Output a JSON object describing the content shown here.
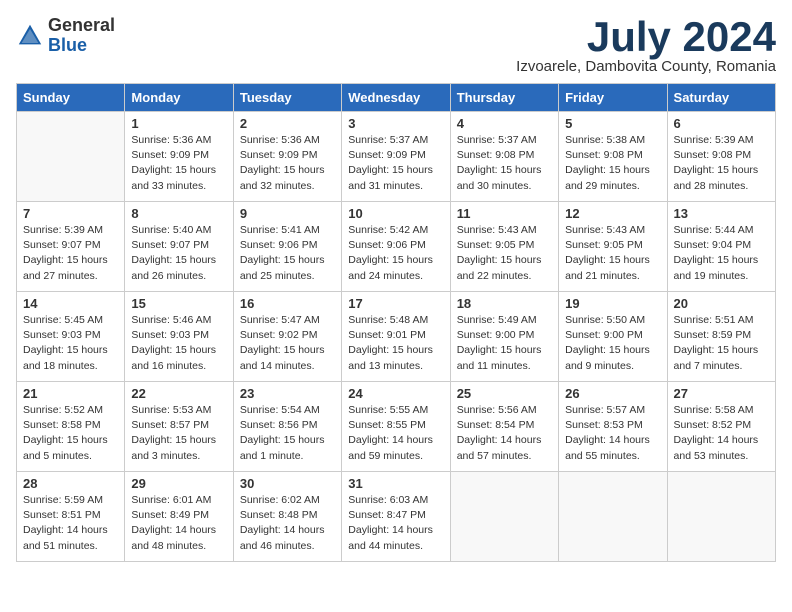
{
  "header": {
    "logo_general": "General",
    "logo_blue": "Blue",
    "title": "July 2024",
    "subtitle": "Izvoarele, Dambovita County, Romania"
  },
  "weekdays": [
    "Sunday",
    "Monday",
    "Tuesday",
    "Wednesday",
    "Thursday",
    "Friday",
    "Saturday"
  ],
  "weeks": [
    [
      {
        "day": "",
        "info": ""
      },
      {
        "day": "1",
        "info": "Sunrise: 5:36 AM\nSunset: 9:09 PM\nDaylight: 15 hours\nand 33 minutes."
      },
      {
        "day": "2",
        "info": "Sunrise: 5:36 AM\nSunset: 9:09 PM\nDaylight: 15 hours\nand 32 minutes."
      },
      {
        "day": "3",
        "info": "Sunrise: 5:37 AM\nSunset: 9:09 PM\nDaylight: 15 hours\nand 31 minutes."
      },
      {
        "day": "4",
        "info": "Sunrise: 5:37 AM\nSunset: 9:08 PM\nDaylight: 15 hours\nand 30 minutes."
      },
      {
        "day": "5",
        "info": "Sunrise: 5:38 AM\nSunset: 9:08 PM\nDaylight: 15 hours\nand 29 minutes."
      },
      {
        "day": "6",
        "info": "Sunrise: 5:39 AM\nSunset: 9:08 PM\nDaylight: 15 hours\nand 28 minutes."
      }
    ],
    [
      {
        "day": "7",
        "info": "Sunrise: 5:39 AM\nSunset: 9:07 PM\nDaylight: 15 hours\nand 27 minutes."
      },
      {
        "day": "8",
        "info": "Sunrise: 5:40 AM\nSunset: 9:07 PM\nDaylight: 15 hours\nand 26 minutes."
      },
      {
        "day": "9",
        "info": "Sunrise: 5:41 AM\nSunset: 9:06 PM\nDaylight: 15 hours\nand 25 minutes."
      },
      {
        "day": "10",
        "info": "Sunrise: 5:42 AM\nSunset: 9:06 PM\nDaylight: 15 hours\nand 24 minutes."
      },
      {
        "day": "11",
        "info": "Sunrise: 5:43 AM\nSunset: 9:05 PM\nDaylight: 15 hours\nand 22 minutes."
      },
      {
        "day": "12",
        "info": "Sunrise: 5:43 AM\nSunset: 9:05 PM\nDaylight: 15 hours\nand 21 minutes."
      },
      {
        "day": "13",
        "info": "Sunrise: 5:44 AM\nSunset: 9:04 PM\nDaylight: 15 hours\nand 19 minutes."
      }
    ],
    [
      {
        "day": "14",
        "info": "Sunrise: 5:45 AM\nSunset: 9:03 PM\nDaylight: 15 hours\nand 18 minutes."
      },
      {
        "day": "15",
        "info": "Sunrise: 5:46 AM\nSunset: 9:03 PM\nDaylight: 15 hours\nand 16 minutes."
      },
      {
        "day": "16",
        "info": "Sunrise: 5:47 AM\nSunset: 9:02 PM\nDaylight: 15 hours\nand 14 minutes."
      },
      {
        "day": "17",
        "info": "Sunrise: 5:48 AM\nSunset: 9:01 PM\nDaylight: 15 hours\nand 13 minutes."
      },
      {
        "day": "18",
        "info": "Sunrise: 5:49 AM\nSunset: 9:00 PM\nDaylight: 15 hours\nand 11 minutes."
      },
      {
        "day": "19",
        "info": "Sunrise: 5:50 AM\nSunset: 9:00 PM\nDaylight: 15 hours\nand 9 minutes."
      },
      {
        "day": "20",
        "info": "Sunrise: 5:51 AM\nSunset: 8:59 PM\nDaylight: 15 hours\nand 7 minutes."
      }
    ],
    [
      {
        "day": "21",
        "info": "Sunrise: 5:52 AM\nSunset: 8:58 PM\nDaylight: 15 hours\nand 5 minutes."
      },
      {
        "day": "22",
        "info": "Sunrise: 5:53 AM\nSunset: 8:57 PM\nDaylight: 15 hours\nand 3 minutes."
      },
      {
        "day": "23",
        "info": "Sunrise: 5:54 AM\nSunset: 8:56 PM\nDaylight: 15 hours\nand 1 minute."
      },
      {
        "day": "24",
        "info": "Sunrise: 5:55 AM\nSunset: 8:55 PM\nDaylight: 14 hours\nand 59 minutes."
      },
      {
        "day": "25",
        "info": "Sunrise: 5:56 AM\nSunset: 8:54 PM\nDaylight: 14 hours\nand 57 minutes."
      },
      {
        "day": "26",
        "info": "Sunrise: 5:57 AM\nSunset: 8:53 PM\nDaylight: 14 hours\nand 55 minutes."
      },
      {
        "day": "27",
        "info": "Sunrise: 5:58 AM\nSunset: 8:52 PM\nDaylight: 14 hours\nand 53 minutes."
      }
    ],
    [
      {
        "day": "28",
        "info": "Sunrise: 5:59 AM\nSunset: 8:51 PM\nDaylight: 14 hours\nand 51 minutes."
      },
      {
        "day": "29",
        "info": "Sunrise: 6:01 AM\nSunset: 8:49 PM\nDaylight: 14 hours\nand 48 minutes."
      },
      {
        "day": "30",
        "info": "Sunrise: 6:02 AM\nSunset: 8:48 PM\nDaylight: 14 hours\nand 46 minutes."
      },
      {
        "day": "31",
        "info": "Sunrise: 6:03 AM\nSunset: 8:47 PM\nDaylight: 14 hours\nand 44 minutes."
      },
      {
        "day": "",
        "info": ""
      },
      {
        "day": "",
        "info": ""
      },
      {
        "day": "",
        "info": ""
      }
    ]
  ]
}
